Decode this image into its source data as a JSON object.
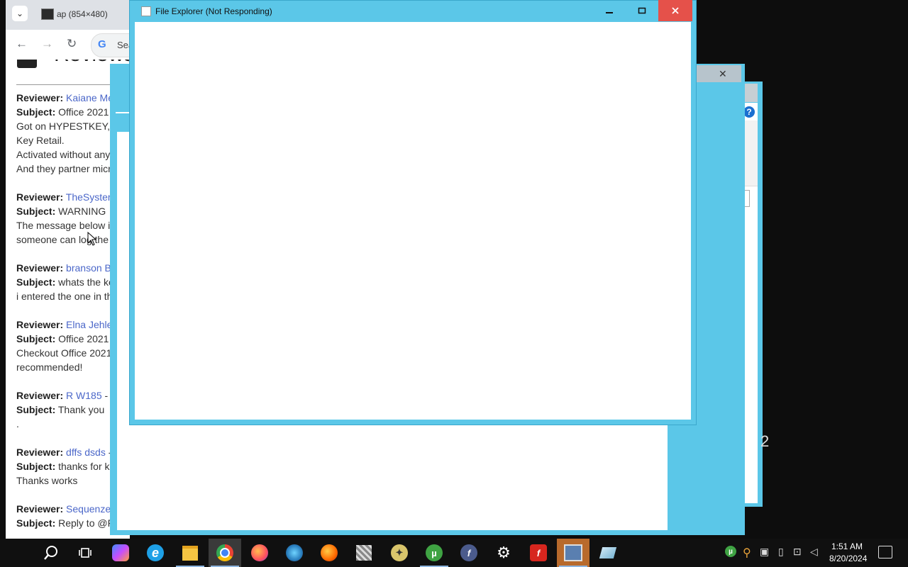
{
  "chrome": {
    "tab_title": "ap (854×480)",
    "omnibox_text": "Sea",
    "heading": "Reviews"
  },
  "reviews": [
    {
      "lines": [
        {
          "label": "Reviewer:",
          "link": "Kaiane Meland"
        },
        {
          "label": "Subject:",
          "text": "Office 2021"
        },
        {
          "text": "Got on HYPESTKEY,"
        },
        {
          "text": "Key Retail."
        },
        {
          "text": "Activated without any"
        },
        {
          "text": "And they partner micr"
        }
      ]
    },
    {
      "lines": [
        {
          "label": "Reviewer:",
          "link": "TheSyster"
        },
        {
          "label": "Subject:",
          "text": "WARNING"
        },
        {
          "text": "The message below i"
        },
        {
          "text": "someone can log the"
        }
      ]
    },
    {
      "lines": [
        {
          "label": "Reviewer:",
          "link": "branson B"
        },
        {
          "label": "Subject:",
          "text": "whats the ke"
        },
        {
          "text": "i entered the one in th"
        }
      ]
    },
    {
      "lines": [
        {
          "label": "Reviewer:",
          "link": "Elna Jehle"
        },
        {
          "label": "Subject:",
          "text": "Office 2021"
        },
        {
          "text": "Checkout Office 2021"
        },
        {
          "text": "recommended!"
        }
      ]
    },
    {
      "lines": [
        {
          "label": "Reviewer:",
          "link": "R W185",
          "suffix": " -"
        },
        {
          "label": "Subject:",
          "text": "Thank you"
        },
        {
          "text": "."
        }
      ]
    },
    {
      "lines": [
        {
          "label": "Reviewer:",
          "link": "dffs dsds",
          "suffix": " -"
        },
        {
          "label": "Subject:",
          "text": "thanks for ke"
        },
        {
          "text": "Thanks works"
        }
      ]
    },
    {
      "lines": [
        {
          "label": "Reviewer:",
          "link": "Sequenze"
        },
        {
          "label": "Subject:",
          "text": "Reply to @F"
        }
      ]
    }
  ],
  "file_explorer": {
    "title": "File Explorer (Not Responding)"
  },
  "background": {
    "digit": "2"
  },
  "taskbar": {
    "apps": [
      "search",
      "task-view",
      "copilot",
      "internet-explorer",
      "file-explorer",
      "chrome",
      "firefox",
      "app-globe",
      "firefox",
      "app-hash",
      "app-bird",
      "utorrent",
      "app-flash",
      "settings",
      "flash-player",
      "app-network",
      "app-monitor"
    ],
    "clock_time": "1:51 AM",
    "clock_date": "8/20/2024"
  },
  "colors": {
    "window_frame": "#5bc7e8",
    "close_red": "#e5514a",
    "link_blue": "#4b67c9",
    "taskbar": "#101010"
  }
}
